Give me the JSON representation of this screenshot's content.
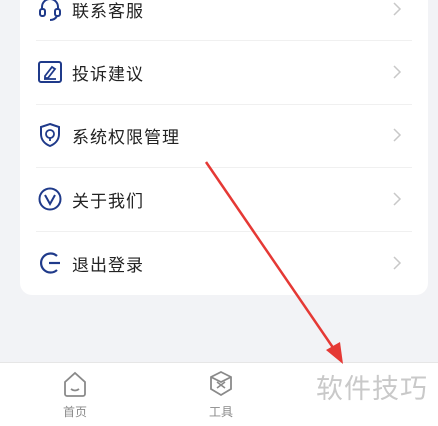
{
  "menu": {
    "items": [
      {
        "label": "联系客服",
        "icon": "headset-icon"
      },
      {
        "label": "投诉建议",
        "icon": "complaint-icon"
      },
      {
        "label": "系统权限管理",
        "icon": "shield-icon"
      },
      {
        "label": "关于我们",
        "icon": "info-circle-icon"
      },
      {
        "label": "退出登录",
        "icon": "logout-icon"
      }
    ]
  },
  "tabbar": {
    "home_label": "首页",
    "tools_label": "工具"
  },
  "watermark": {
    "text": "软件技巧"
  },
  "colors": {
    "accent": "#1f3a8a",
    "arrow": "#e53935",
    "chevron": "#c8c8c8",
    "tab_icon": "#8a8a8a"
  }
}
